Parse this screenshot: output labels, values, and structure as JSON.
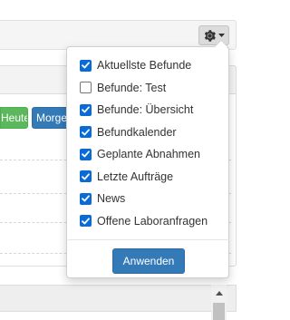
{
  "toolbar": {
    "settings_icon": "gear-icon",
    "caret_icon": "caret-down-icon"
  },
  "background": {
    "btn_heute_label": "Heute",
    "btn_morgen_label": "Morgen",
    "colors": {
      "success": "#5cb85c",
      "primary": "#337ab7"
    }
  },
  "menu": {
    "items": [
      {
        "label": "Aktuellste Befunde",
        "checked": true
      },
      {
        "label": "Befunde: Test",
        "checked": false
      },
      {
        "label": "Befunde: Übersicht",
        "checked": true
      },
      {
        "label": "Befundkalender",
        "checked": true
      },
      {
        "label": "Geplante Abnahmen",
        "checked": true
      },
      {
        "label": "Letzte Aufträge",
        "checked": true
      },
      {
        "label": "News",
        "checked": true
      },
      {
        "label": "Offene Laboranfragen",
        "checked": true
      }
    ],
    "apply_label": "Anwenden",
    "checkbox_color": "#0b6bd6"
  }
}
